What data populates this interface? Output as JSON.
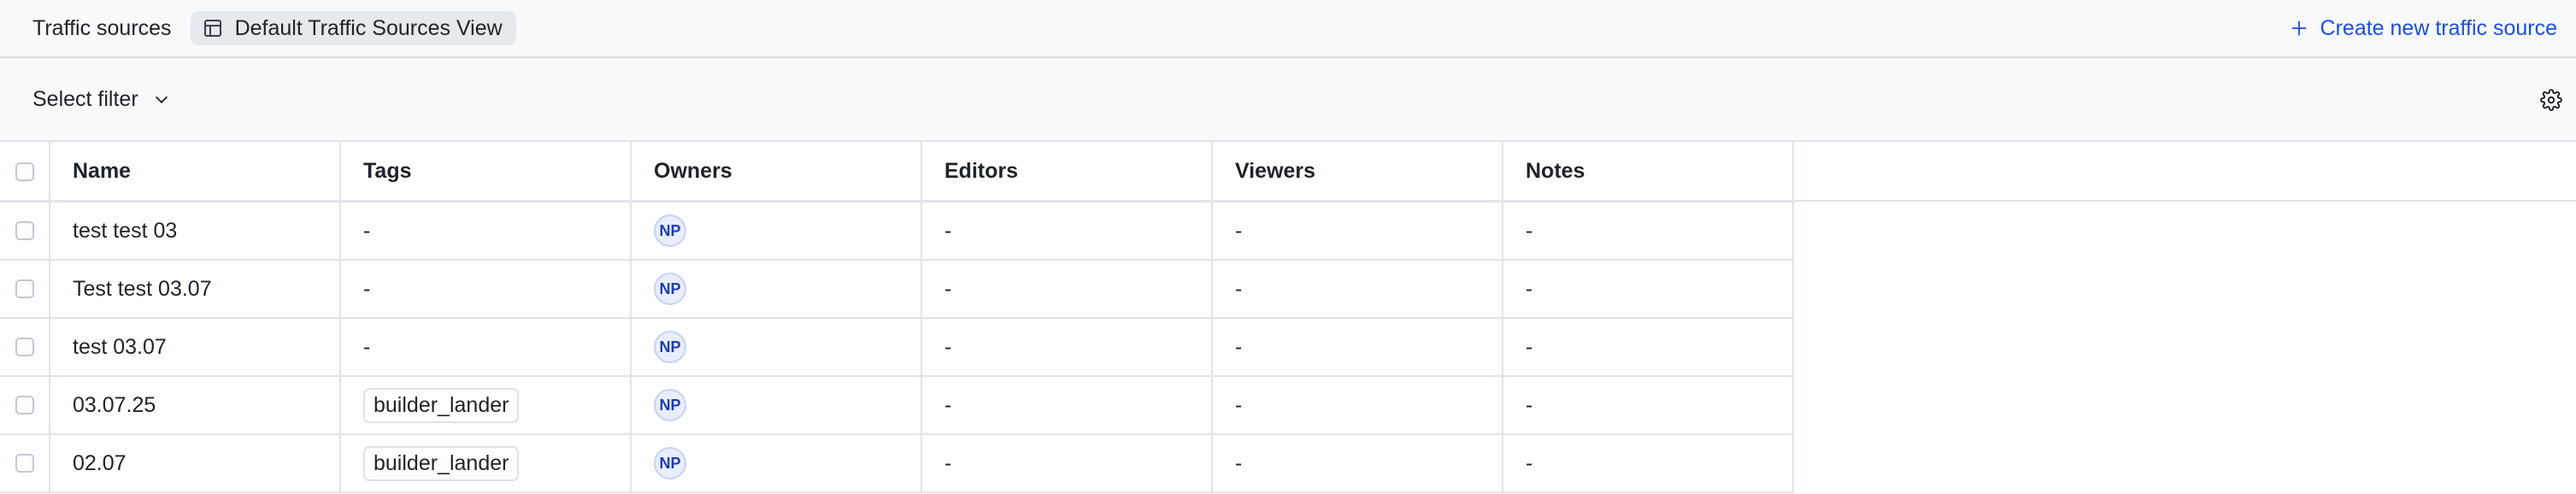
{
  "header": {
    "title": "Traffic sources",
    "view_label": "Default Traffic Sources View",
    "create_label": "Create new traffic source"
  },
  "filter": {
    "select_label": "Select filter"
  },
  "table": {
    "columns": [
      "Name",
      "Tags",
      "Owners",
      "Editors",
      "Viewers",
      "Notes"
    ],
    "rows": [
      {
        "name": "test test 03",
        "tags": "-",
        "tag_chip": false,
        "owner": "NP",
        "editors": "-",
        "viewers": "-",
        "notes": "-"
      },
      {
        "name": "Test test 03.07",
        "tags": "-",
        "tag_chip": false,
        "owner": "NP",
        "editors": "-",
        "viewers": "-",
        "notes": "-"
      },
      {
        "name": "test 03.07",
        "tags": "-",
        "tag_chip": false,
        "owner": "NP",
        "editors": "-",
        "viewers": "-",
        "notes": "-"
      },
      {
        "name": "03.07.25",
        "tags": "builder_lander",
        "tag_chip": true,
        "owner": "NP",
        "editors": "-",
        "viewers": "-",
        "notes": "-"
      },
      {
        "name": "02.07",
        "tags": "builder_lander",
        "tag_chip": true,
        "owner": "NP",
        "editors": "-",
        "viewers": "-",
        "notes": "-"
      }
    ]
  },
  "colors": {
    "accent": "#1d4fd8",
    "header_bg": "#f8f9fa",
    "border": "#e1e4e8"
  }
}
